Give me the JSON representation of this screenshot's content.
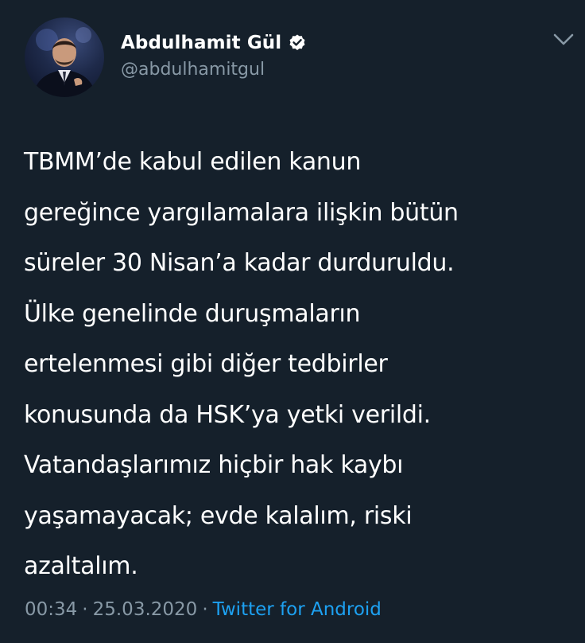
{
  "author": {
    "display_name": "Abdulhamit Gül",
    "handle": "@abdulhamitgul",
    "verified": true,
    "avatar_icon": "profile-photo"
  },
  "tweet": {
    "lines": [
      "TBMM’de kabul edilen kanun",
      "gereğince yargılamalara ilişkin bütün",
      "süreler 30 Nisan’a kadar durduruldu.",
      "Ülke genelinde duruşmaların",
      "ertelenmesi gibi diğer tedbirler",
      "konusunda da HSK’ya yetki verildi.",
      "Vatandaşlarımız hiçbir hak kaybı",
      "yaşamayacak; evde kalalım, riski",
      "azaltalım."
    ]
  },
  "meta": {
    "time": "00:34",
    "date": "25.03.2020",
    "separator": "·",
    "source": "Twitter for Android"
  },
  "colors": {
    "background": "#15202b",
    "text": "#ffffff",
    "secondary": "#8899a6",
    "link": "#1da1f2"
  }
}
